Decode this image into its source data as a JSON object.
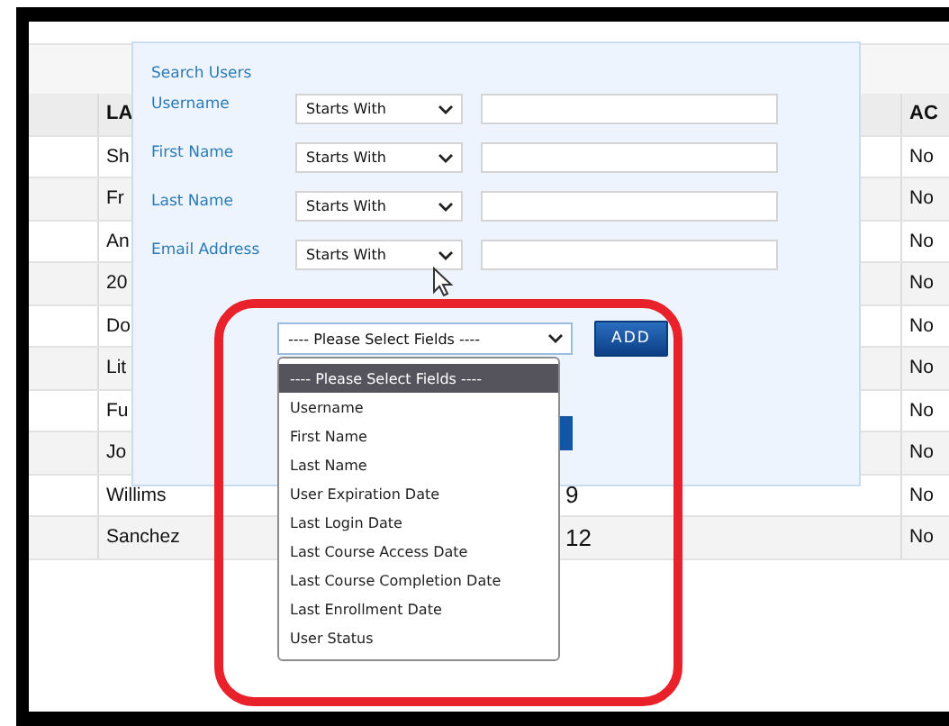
{
  "table": {
    "columns": [
      "LA",
      "AC"
    ],
    "rows": [
      {
        "name": "Sh",
        "status": "No"
      },
      {
        "name": "Fr",
        "status": "No"
      },
      {
        "name": "An",
        "status": "No"
      },
      {
        "name": "20",
        "status": "No"
      },
      {
        "name": "Do",
        "status": "No"
      },
      {
        "name": "Lit",
        "status": "No"
      },
      {
        "name": "Fu",
        "status": "No"
      },
      {
        "name": "Jo",
        "status": "No"
      },
      {
        "name": "Willims",
        "partial": "9",
        "status": "No"
      },
      {
        "name": "Sanchez",
        "partial": "12",
        "status": "No"
      }
    ]
  },
  "search_panel": {
    "title": "Search Users",
    "filters": [
      {
        "label": "Username",
        "operator": "Starts With"
      },
      {
        "label": "First Name",
        "operator": "Starts With"
      },
      {
        "label": "Last Name",
        "operator": "Starts With"
      },
      {
        "label": "Email Address",
        "operator": "Starts With"
      }
    ],
    "field_select": {
      "value": "---- Please Select Fields ----",
      "expanded": true,
      "options": [
        {
          "label": "---- Please Select Fields ----",
          "selected": true
        },
        {
          "label": "Username",
          "selected": false
        },
        {
          "label": "First Name",
          "selected": false
        },
        {
          "label": "Last Name",
          "selected": false
        },
        {
          "label": "User Expiration Date",
          "selected": false
        },
        {
          "label": "Last Login Date",
          "selected": false
        },
        {
          "label": "Last Course Access Date",
          "selected": false
        },
        {
          "label": "Last Course Completion Date",
          "selected": false
        },
        {
          "label": "Last Enrollment Date",
          "selected": false
        },
        {
          "label": "User Status",
          "selected": false
        }
      ]
    },
    "add_button": "ADD"
  }
}
